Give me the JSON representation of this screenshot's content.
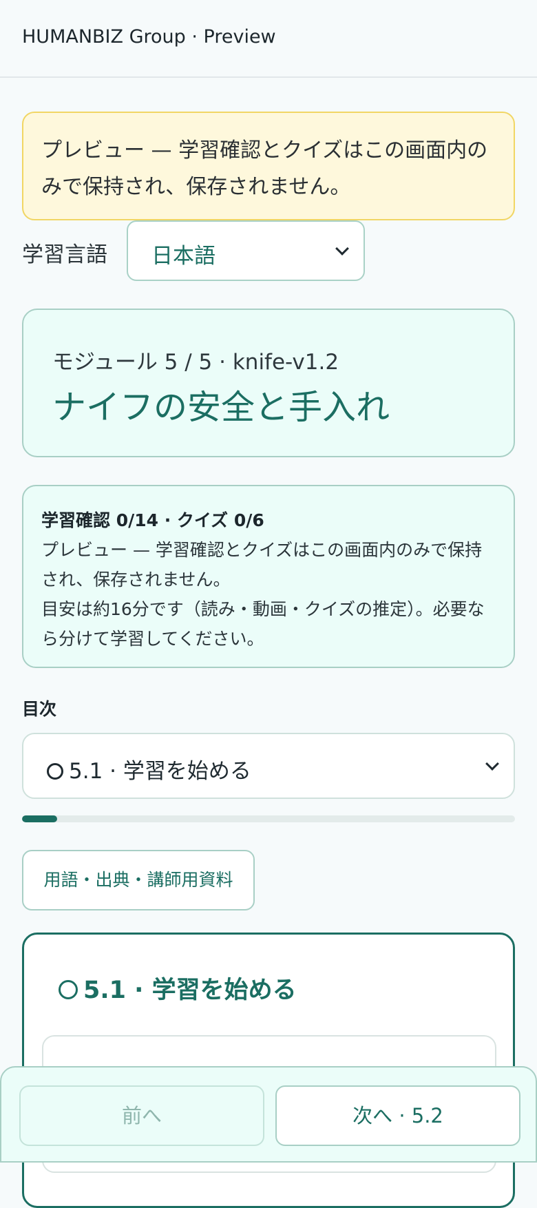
{
  "header": {
    "title": "HUMANBIZ Group · Preview"
  },
  "notice": {
    "text": "プレビュー — 学習確認とクイズはこの画面内のみで保持され、保存されません。"
  },
  "language": {
    "label": "学習言語",
    "selected": "日本語"
  },
  "module": {
    "meta": "モジュール 5 / 5 · knife-v1.2",
    "title": "ナイフの安全と手入れ"
  },
  "progress": {
    "counts": "学習確認 0/14 · クイズ 0/6",
    "preview_note": "プレビュー — 学習確認とクイズはこの画面内のみで保持され、保存されません。",
    "estimate": "目安は約16分です（読み・動画・クイズの推定）。必要なら分けて学習してください。",
    "fraction": 0.071
  },
  "toc": {
    "label": "目次",
    "selected": "5.1 · 学習を始める"
  },
  "glossary_button": "用語・出典・講師用資料",
  "section": {
    "title": "5.1 · 学習を始める"
  },
  "nav": {
    "prev_label": "前へ",
    "next_label": "次へ · 5.2"
  },
  "colors": {
    "accent": "#1b6e62",
    "notice_bg": "#fef8dc",
    "card_bg": "#ebfdf9"
  }
}
